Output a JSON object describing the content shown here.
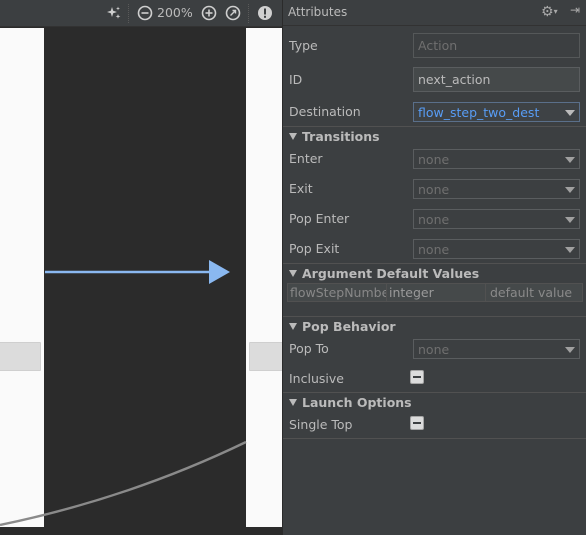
{
  "toolbar": {
    "zoom_label": "200%",
    "icons": [
      "auto-arrange-icon",
      "zoom-out-icon",
      "zoom-in-icon",
      "zoom-fit-icon",
      "warning-icon"
    ]
  },
  "panel": {
    "title": "Attributes",
    "fields": {
      "type_label": "Type",
      "type_placeholder": "Action",
      "id_label": "ID",
      "id_value": "next_action",
      "destination_label": "Destination",
      "destination_value": "flow_step_two_dest"
    },
    "transitions": {
      "header": "Transitions",
      "enter_label": "Enter",
      "enter_value": "none",
      "exit_label": "Exit",
      "exit_value": "none",
      "pop_enter_label": "Pop Enter",
      "pop_enter_value": "none",
      "pop_exit_label": "Pop Exit",
      "pop_exit_value": "none"
    },
    "arguments": {
      "header": "Argument Default Values",
      "name": "flowStepNumbe",
      "type": "integer",
      "default_value": "default value"
    },
    "pop_behavior": {
      "header": "Pop Behavior",
      "pop_to_label": "Pop To",
      "pop_to_value": "none",
      "inclusive_label": "Inclusive"
    },
    "launch_options": {
      "header": "Launch Options",
      "single_top_label": "Single Top"
    }
  },
  "colors": {
    "accent_blue": "#589df6",
    "action_arrow": "#8ab8f0",
    "panel_bg": "#3c3f41",
    "canvas_bg": "#2b2b2b"
  }
}
